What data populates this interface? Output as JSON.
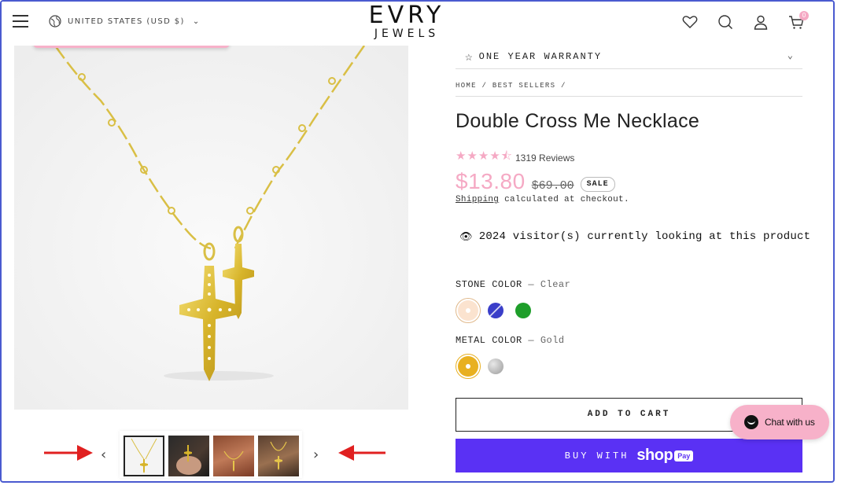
{
  "header": {
    "country_selector": "UNITED STATES (USD $)",
    "logo_top": "EVRY",
    "logo_bottom": "JEWELS",
    "cart_count": "0",
    "icons": [
      "menu-icon",
      "globe-icon",
      "heart-icon",
      "search-icon",
      "account-icon",
      "cart-icon"
    ]
  },
  "gallery": {
    "prev_label": "‹",
    "next_label": "›",
    "thumbnails": [
      "necklace-product",
      "necklace-on-hand",
      "necklace-on-model",
      "necklace-on-neck"
    ]
  },
  "product": {
    "accordion_warranty": "ONE YEAR WARRANTY",
    "breadcrumb": "HOME / BEST SELLERS /",
    "title": "Double Cross Me Necklace",
    "rating_stars": "★★★★⯪",
    "rating": 4.5,
    "reviews": "1319 Reviews",
    "price": "$13.80",
    "compare_price": "$69.00",
    "sale_badge": "SALE",
    "shipping_link": "Shipping",
    "shipping_rest": " calculated at checkout.",
    "visitors": "2024 visitor(s) currently looking at this product",
    "stone_label": "STONE COLOR",
    "stone_value": "Clear",
    "stone_options": [
      {
        "name": "Clear",
        "color": "#fbe3cf"
      },
      {
        "name": "Blue",
        "color": "#3a3ec9"
      },
      {
        "name": "Green",
        "color": "#1e9e2a"
      }
    ],
    "metal_label": "METAL COLOR",
    "metal_value": "Gold",
    "metal_options": [
      {
        "name": "Gold",
        "color": "#e8b020"
      },
      {
        "name": "Silver",
        "color": "#9a9a9a"
      }
    ],
    "separator": "—",
    "add_to_cart": "ADD TO CART",
    "buy_with": "BUY WITH",
    "shop_brand": "shop",
    "shop_pay": "Pay"
  },
  "chat": {
    "label": "Chat with us"
  },
  "colors": {
    "accent_pink": "#f5a9c4",
    "shop_purple": "#5a31f4",
    "frame_blue": "#4a5ad0",
    "annotation_red": "#e02020"
  }
}
